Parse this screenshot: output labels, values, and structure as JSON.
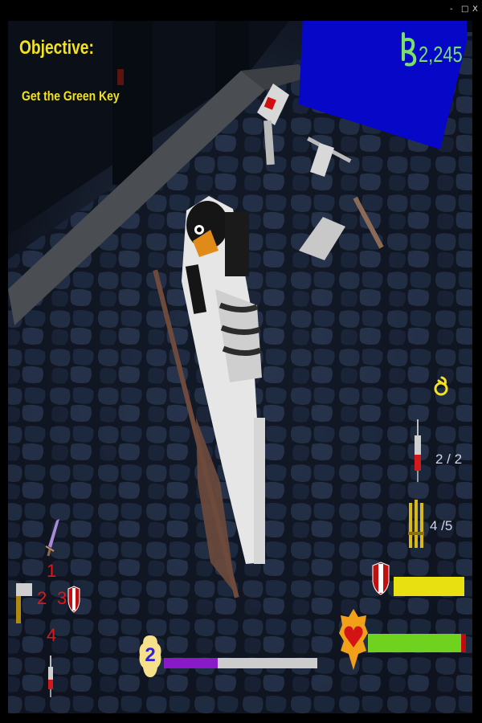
{
  "window": {
    "minimize_label": "-",
    "restore_label": "□",
    "close_label": "X"
  },
  "objective": {
    "title": "Objective:",
    "text": "Get the Green Key"
  },
  "currency": {
    "amount": "2,245",
    "icon": "currency-symbol-icon",
    "color": "#79e06a"
  },
  "ammo": {
    "syringes": {
      "count": "2 / 2",
      "icon": "syringe-icon"
    },
    "bullets": {
      "count": "4  /5",
      "icon": "bullets-icon"
    },
    "top_icon": "grenade-icon"
  },
  "hotbar": {
    "slots": [
      {
        "number": "1",
        "icon": "sword-icon"
      },
      {
        "number": "2",
        "icon": "hammer-icon"
      },
      {
        "number": "3",
        "icon": "shield-icon"
      },
      {
        "number": "4",
        "icon": "syringe-icon"
      }
    ]
  },
  "level": {
    "value": "2",
    "xp_fraction": 0.35,
    "bar_color": "#8a1ac8"
  },
  "armor": {
    "fraction": 1.0,
    "bar_color": "#e8e010"
  },
  "health": {
    "fraction": 0.95,
    "bar_color": "#6ed21e",
    "damage_color": "#c40a0a"
  }
}
